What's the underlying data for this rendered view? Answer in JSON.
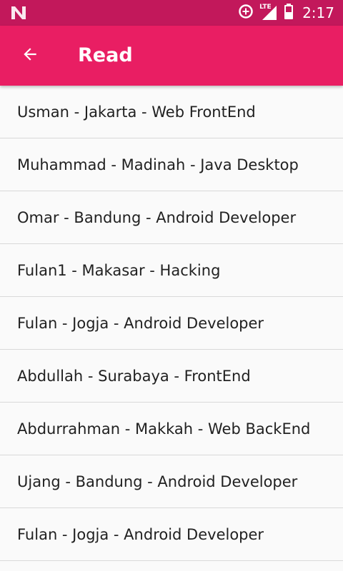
{
  "status_bar": {
    "time": "2:17",
    "network_label": "LTE",
    "icons": [
      "notification-n-icon",
      "data-saver-icon",
      "signal-icon",
      "battery-icon"
    ]
  },
  "app_bar": {
    "title": "Read",
    "back_icon": "arrow-back-icon"
  },
  "colors": {
    "status_bar": "#c2185b",
    "app_bar": "#e91e63",
    "background": "#fafafa",
    "divider": "#d9d9d9",
    "text": "#212121"
  },
  "list": {
    "items": [
      {
        "label": "Usman - Jakarta - Web FrontEnd"
      },
      {
        "label": "Muhammad - Madinah - Java Desktop"
      },
      {
        "label": "Omar - Bandung - Android Developer"
      },
      {
        "label": "Fulan1 - Makasar - Hacking"
      },
      {
        "label": "Fulan - Jogja - Android Developer"
      },
      {
        "label": "Abdullah - Surabaya - FrontEnd"
      },
      {
        "label": "Abdurrahman - Makkah - Web BackEnd"
      },
      {
        "label": "Ujang - Bandung - Android Developer"
      },
      {
        "label": "Fulan - Jogja - Android Developer"
      }
    ]
  }
}
